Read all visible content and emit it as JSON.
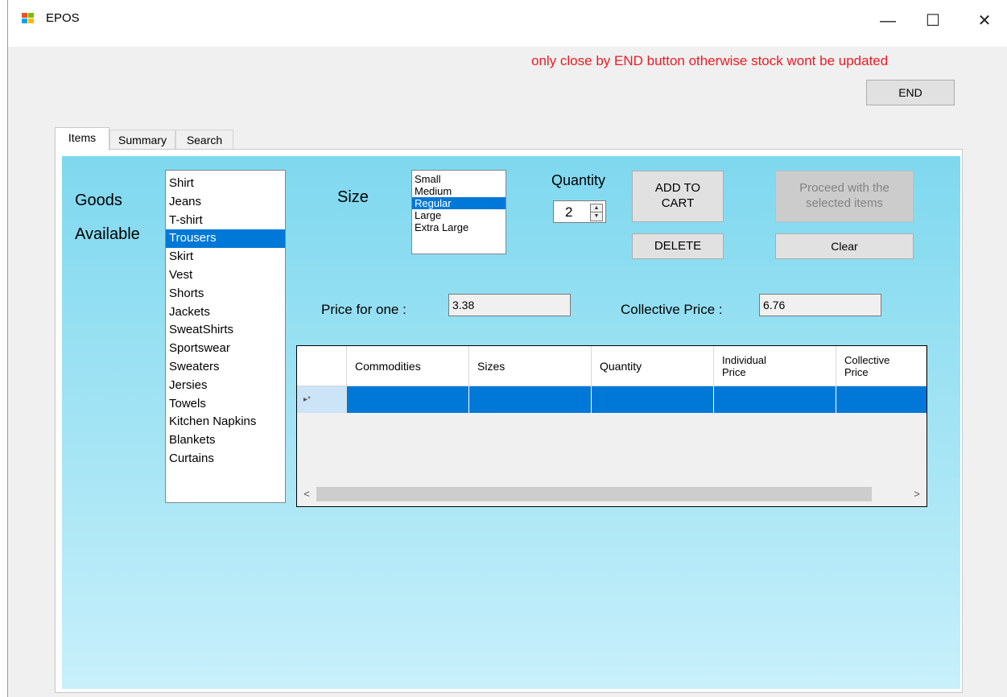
{
  "window": {
    "title": "EPOS"
  },
  "window_controls": {
    "minimize": "—",
    "maximize": "☐",
    "close": "✕"
  },
  "warning": "only close by END button otherwise stock wont be updated",
  "end_button": "END",
  "tabs": [
    {
      "label": "Items",
      "active": true
    },
    {
      "label": "Summary"
    },
    {
      "label": "Search"
    }
  ],
  "goods": {
    "label_line1": "Goods",
    "label_line2": "Available",
    "items": [
      "Shirt",
      "Jeans",
      "T-shirt",
      "Trousers",
      "Skirt",
      "Vest",
      "Shorts",
      "Jackets",
      "SweatShirts",
      "Sportswear",
      "Sweaters",
      "Jersies",
      "Towels",
      "Kitchen Napkins",
      "Blankets",
      "Curtains"
    ],
    "selected": "Trousers"
  },
  "size": {
    "label": "Size",
    "options": [
      "Small",
      "Medium",
      "Regular",
      "Large",
      "Extra Large"
    ],
    "selected": "Regular"
  },
  "quantity": {
    "label": "Quantity",
    "value": "2"
  },
  "buttons": {
    "add_to_cart_line1": "ADD TO",
    "add_to_cart_line2": "CART",
    "delete": "DELETE",
    "proceed_line1": "Proceed with the",
    "proceed_line2": "selected items",
    "clear": "Clear"
  },
  "price": {
    "one_label": "Price for one :",
    "one_value": "3.38",
    "collective_label": "Collective Price :",
    "collective_value": "6.76"
  },
  "grid": {
    "columns": [
      {
        "line1": "Commodities",
        "line2": ""
      },
      {
        "line1": "Sizes",
        "line2": ""
      },
      {
        "line1": "Quantity",
        "line2": ""
      },
      {
        "line1": "Individual",
        "line2": "Price"
      },
      {
        "line1": "Collective",
        "line2": "Price"
      }
    ],
    "new_row_marker": "▸*",
    "scroll_left": "<",
    "scroll_right": ">"
  },
  "colors": {
    "accent": "#0078d7",
    "warning": "#e81d24",
    "panel_top": "#7fd8ef",
    "panel_bottom": "#c8f0fb"
  }
}
